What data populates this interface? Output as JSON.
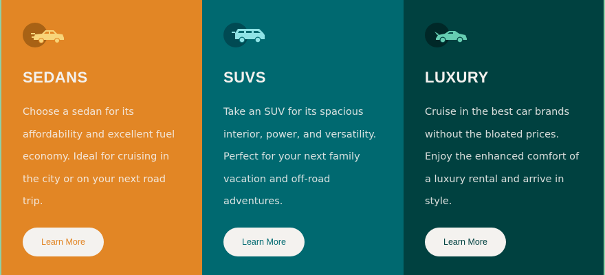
{
  "cards": [
    {
      "title": "SEDANS",
      "description": "Choose a sedan for its affordability and excellent fuel economy. Ideal for cruising in the city or on your next road trip.",
      "button_label": "Learn More",
      "icon": "sedan-car-icon",
      "bg_color": "#e28625",
      "icon_color": "#f8d57a"
    },
    {
      "title": "SUVS",
      "description": "Take an SUV for its spacious interior, power, and versatility. Perfect for your next family vacation and off-road adventures.",
      "button_label": "Learn More",
      "icon": "suv-car-icon",
      "bg_color": "#006970",
      "icon_color": "#8fe3e6"
    },
    {
      "title": "LUXURY",
      "description": "Cruise in the best car brands without the bloated prices. Enjoy the enhanced comfort of a luxury rental and arrive in style.",
      "button_label": "Learn More",
      "icon": "luxury-car-icon",
      "bg_color": "#004140",
      "icon_color": "#66cdb2"
    }
  ],
  "button_bg": "#f4f2ef",
  "text_color": "#f3f1ee"
}
